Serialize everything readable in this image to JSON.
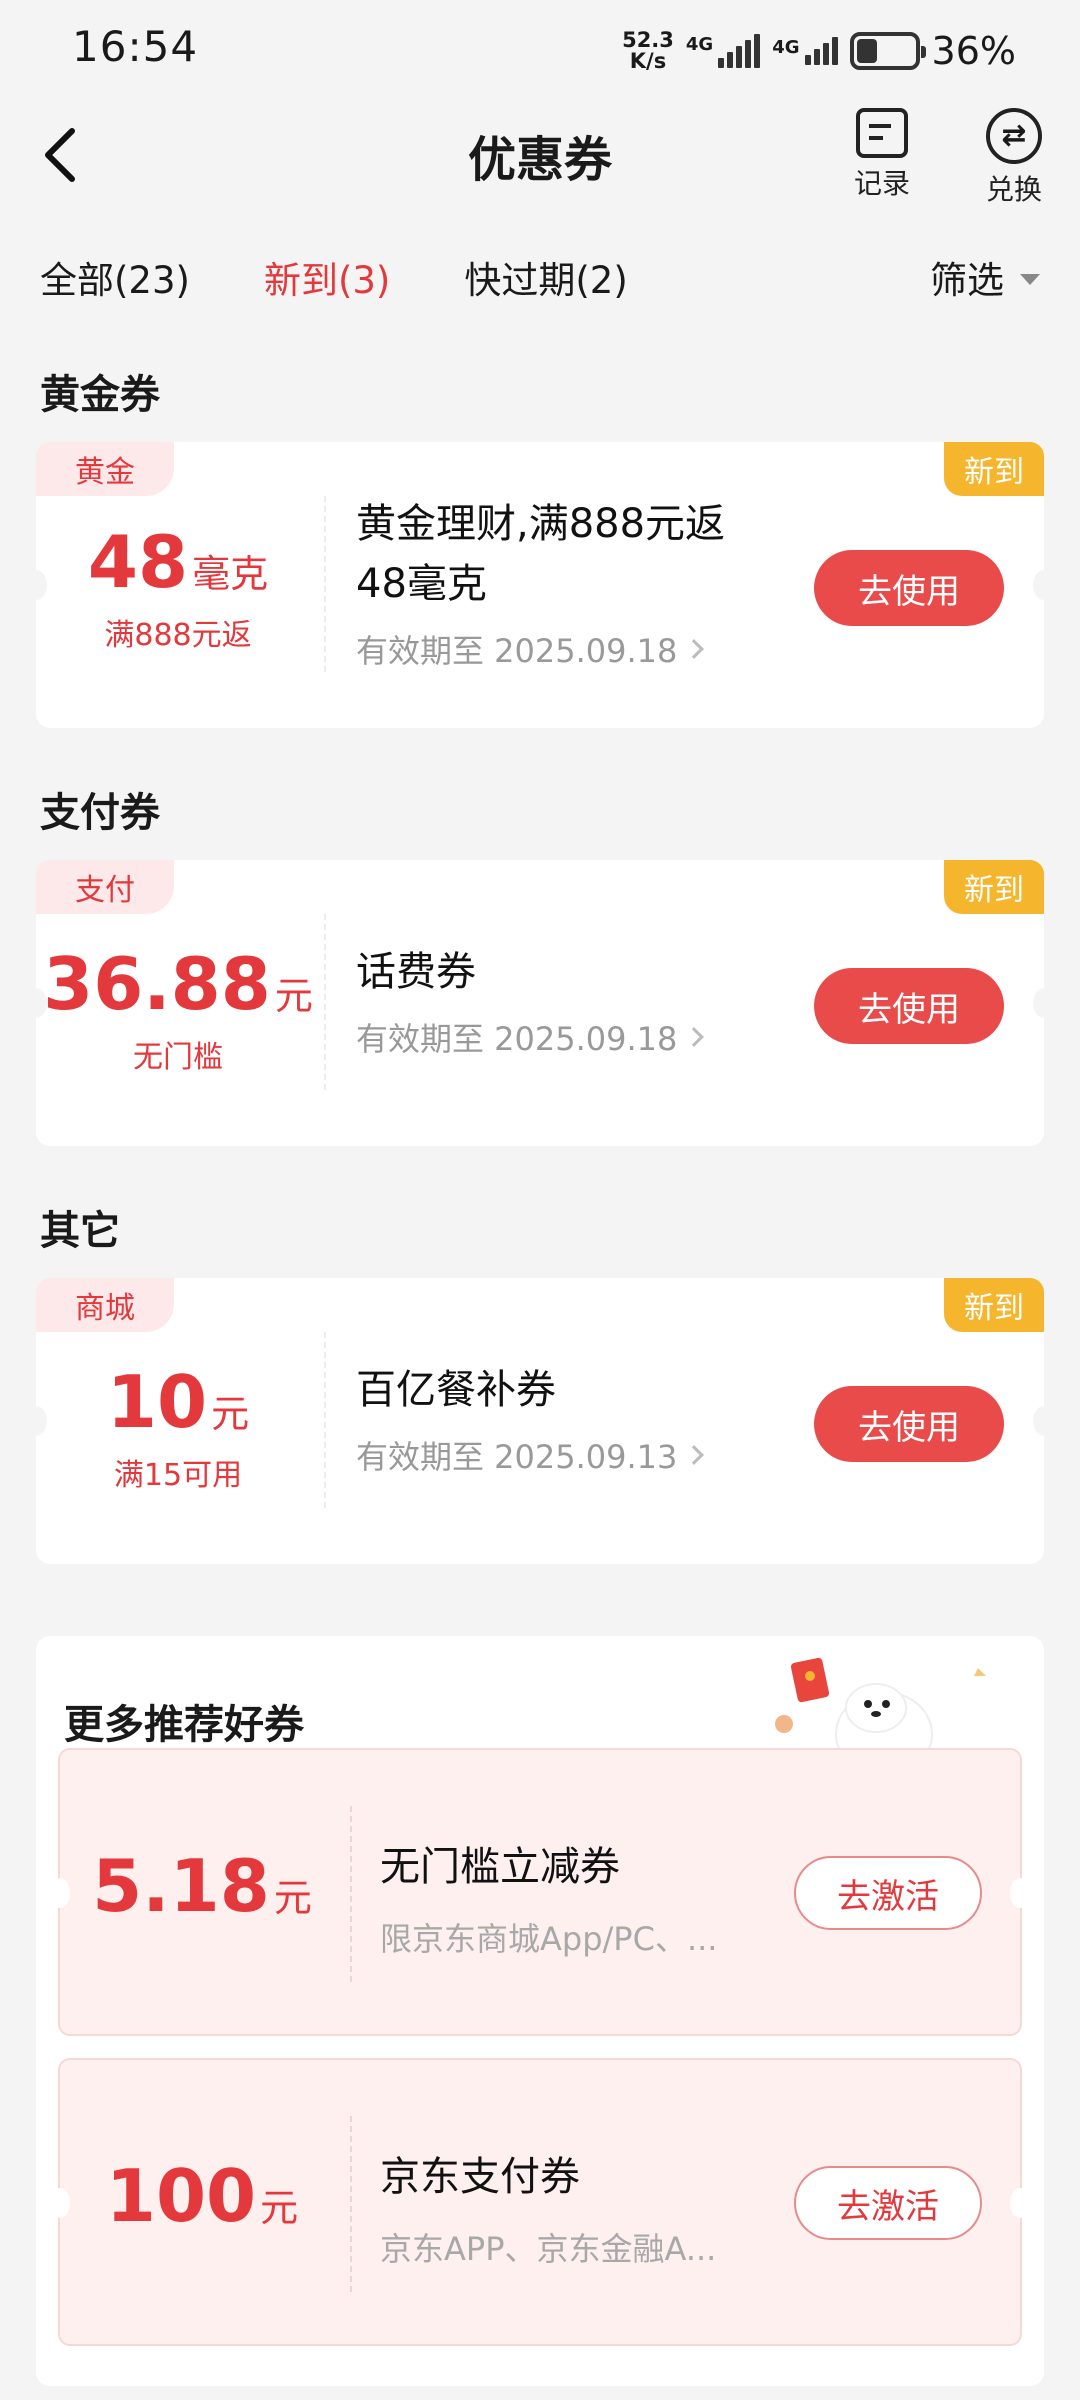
{
  "status": {
    "time": "16:54",
    "speed_top": "52.3",
    "speed_bottom": "K/s",
    "net1": "4G",
    "net2": "4G",
    "battery": "36%"
  },
  "header": {
    "title": "优惠券",
    "record_label": "记录",
    "exchange_label": "兑换"
  },
  "tabs": [
    {
      "label": "全部(23)"
    },
    {
      "label": "新到(3)"
    },
    {
      "label": "快过期(2)"
    }
  ],
  "filter_label": "筛选",
  "sections": [
    {
      "title": "黄金券",
      "coupon": {
        "category": "黄金",
        "new_tag": "新到",
        "amount": "48",
        "unit": "毫克",
        "condition": "满888元返",
        "title_line1": "黄金理财,满888元返",
        "title_line2": "48毫克",
        "valid": "有效期至 2025.09.18",
        "button": "去使用"
      }
    },
    {
      "title": "支付券",
      "coupon": {
        "category": "支付",
        "new_tag": "新到",
        "amount": "36.88",
        "unit": "元",
        "condition": "无门槛",
        "title_line1": "话费券",
        "valid": "有效期至 2025.09.18",
        "button": "去使用"
      }
    },
    {
      "title": "其它",
      "coupon": {
        "category": "商城",
        "new_tag": "新到",
        "amount": "10",
        "unit": "元",
        "condition": "满15可用",
        "title_line1": "百亿餐补券",
        "valid": "有效期至 2025.09.13",
        "button": "去使用"
      }
    }
  ],
  "recommend": {
    "title": "更多推荐好券",
    "items": [
      {
        "amount": "5.18",
        "unit": "元",
        "name": "无门槛立减券",
        "desc": "限京东商城App/PC、...",
        "button": "去激活"
      },
      {
        "amount": "100",
        "unit": "元",
        "name": "京东支付券",
        "desc": "京东APP、京东金融A...",
        "button": "去激活"
      }
    ]
  },
  "colors": {
    "accent": "#e4393c",
    "new_tag": "#f5b52d",
    "background": "#f4f4f4"
  }
}
